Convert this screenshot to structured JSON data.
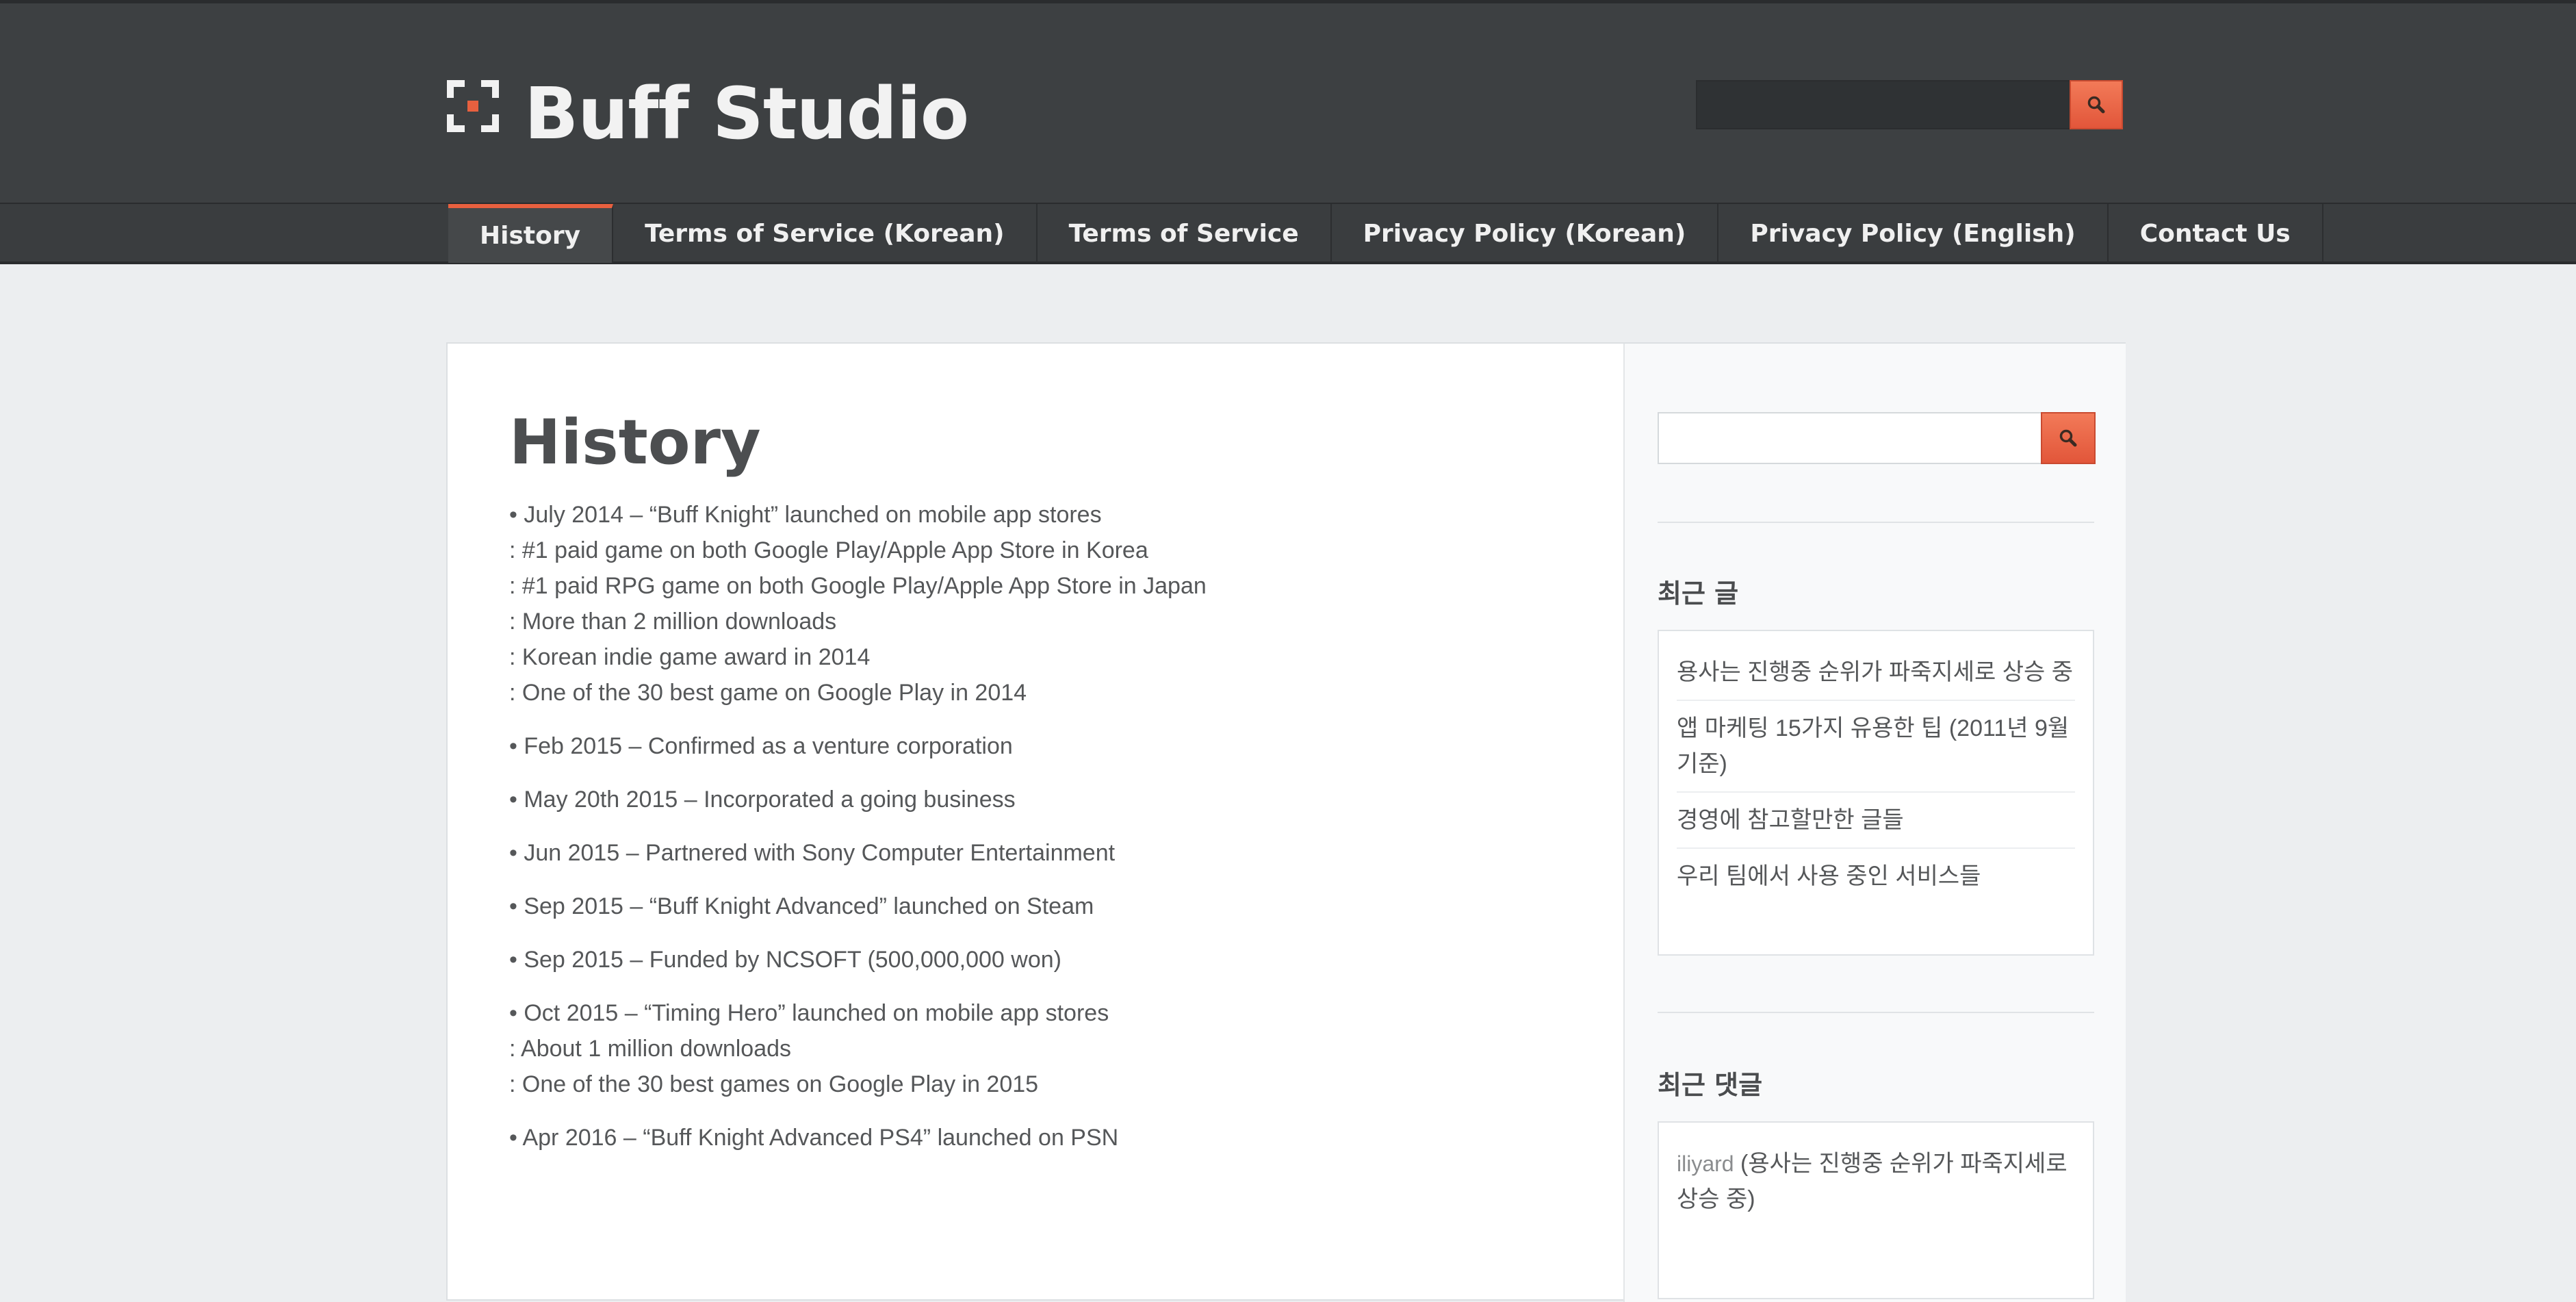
{
  "site": {
    "title": "Buff Studio"
  },
  "nav": {
    "items": [
      {
        "label": "History"
      },
      {
        "label": "Terms of Service (Korean)"
      },
      {
        "label": "Terms of Service"
      },
      {
        "label": "Privacy Policy (Korean)"
      },
      {
        "label": "Privacy Policy (English)"
      },
      {
        "label": "Contact Us"
      }
    ]
  },
  "page": {
    "title": "History"
  },
  "history": [
    [
      "• July 2014 – “Buff Knight” launched on mobile app stores",
      ": #1 paid game on both Google Play/Apple App Store in Korea",
      ": #1 paid RPG game on both Google Play/Apple App Store in Japan",
      ": More than 2 million downloads",
      ": Korean indie game award in 2014",
      ": One of the 30 best game on Google Play in 2014"
    ],
    [
      "• Feb 2015 – Confirmed as a venture corporation"
    ],
    [
      "• May 20th 2015 – Incorporated a going business"
    ],
    [
      "• Jun 2015 – Partnered with Sony Computer Entertainment"
    ],
    [
      "• Sep 2015 – “Buff Knight Advanced” launched on Steam"
    ],
    [
      "• Sep 2015 – Funded by NCSOFT (500,000,000 won)"
    ],
    [
      "• Oct 2015 – “Timing Hero” launched on mobile app stores",
      ": About 1 million downloads",
      ": One of the 30 best games on Google Play in 2015"
    ],
    [
      "• Apr 2016 – “Buff Knight Advanced PS4” launched on PSN"
    ]
  ],
  "sidebar": {
    "recent_posts": {
      "title": "최근 글",
      "items": [
        "용사는 진행중 순위가 파죽지세로 상승 중",
        "앱 마케팅 15가지 유용한 팁 (2011년 9월 기준)",
        "경영에 참고할만한 글들",
        "우리 팀에서 사용 중인 서비스들"
      ]
    },
    "recent_comments": {
      "title": "최근 댓글",
      "items": [
        {
          "author": "iliyard",
          "post": "용사는 진행중 순위가 파죽지세로 상승 중"
        }
      ]
    }
  },
  "colors": {
    "accent": "#e8603f",
    "header_bg": "#3d4042",
    "page_bg": "#eceef0"
  },
  "icons": {
    "logo": "buff-studio-logo-icon",
    "search": "search-icon"
  }
}
